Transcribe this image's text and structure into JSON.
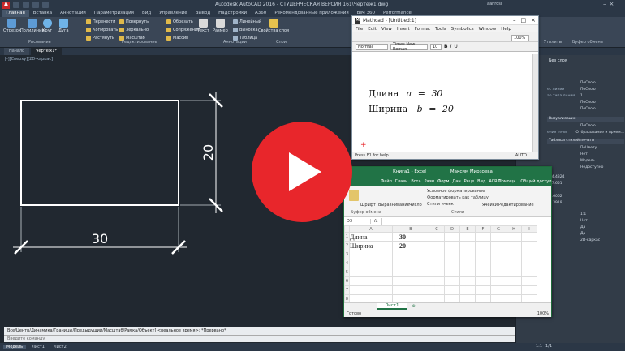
{
  "acad": {
    "title": "Autodesk AutoCAD 2016 - СТУДЕНЧЕСКАЯ ВЕРСИЯ   161\\Чертеж1.dwg",
    "logo": "A",
    "search_hint": "Введите кл. слово/фразу",
    "user": "aahrosl"
  },
  "ribbon_tabs": [
    "Главная",
    "Вставка",
    "Аннотации",
    "Параметризация",
    "Вид",
    "Управление",
    "Вывод",
    "Надстройки",
    "А360",
    "Рекомендованные приложения",
    "BIM 360",
    "Performance"
  ],
  "ribbon": {
    "draw": [
      "Отрезок",
      "Полилиния",
      "Круг",
      "Дуга"
    ],
    "modify": [
      "Перенести",
      "Копировать",
      "Растянуть",
      "Повернуть",
      "Зеркально",
      "Масштаб",
      "Обрезать",
      "Сопряжение",
      "Массив"
    ],
    "annot": [
      "Текст",
      "Размер",
      "Линейный",
      "Выноска",
      "Таблица"
    ],
    "layers": "Свойства слоя",
    "groups": [
      "Рисование",
      "Редактирование",
      "Аннотации",
      "Слои"
    ],
    "right_groups": [
      "Утилиты",
      "Буфер обмена"
    ]
  },
  "doc_tabs": [
    "Начало",
    "Чертеж1*"
  ],
  "viewport_label": "[-][Сверху][2D-каркас]",
  "drawing": {
    "width_dim": "30",
    "height_dim": "20"
  },
  "command": {
    "history": "Все/Центр/Динамика/Границы/Предыдущий/Масштаб/Рамка/Объект] <реальное время>:  *Прервано*",
    "prompt": "Введите команду"
  },
  "status_tabs": [
    "Модель",
    "Лист1",
    "Лист2"
  ],
  "status_right": [
    "1:1",
    "1/1"
  ],
  "palette": {
    "top": "Без слоя",
    "rows": [
      {
        "k": "",
        "v": "ПоСлою"
      },
      {
        "k": "ес линий",
        "v": "ПоСлою"
      },
      {
        "k": "аб типа линий",
        "v": "1"
      },
      {
        "k": "",
        "v": "ПоСлою"
      },
      {
        "k": "",
        "v": "ПоСлою"
      }
    ],
    "section": "Визуализация",
    "rows2": [
      {
        "k": "",
        "v": "ПоСлою"
      },
      {
        "k": "ения тени",
        "v": "Отбрасывание и прием..."
      }
    ],
    "section2": "Таблица стилей печати",
    "rows3": [
      {
        "k": "",
        "v": "ПоЦвету"
      },
      {
        "k": "",
        "v": "Нет"
      },
      {
        "k": "",
        "v": "Модель"
      },
      {
        "k": "",
        "v": "Недоступно"
      }
    ],
    "values": [
      "464.4324",
      "397.651",
      "0",
      "32.6062",
      "82.3919"
    ],
    "bottom": [
      {
        "k": "",
        "v": "1:1"
      },
      {
        "k": "",
        "v": "Нет"
      },
      {
        "k": "",
        "v": "Да"
      },
      {
        "k": "",
        "v": "Да"
      },
      {
        "k": "",
        "v": "2D-каркас"
      }
    ]
  },
  "mathcad": {
    "title": "Mathcad - [Untitled:1]",
    "menu": [
      "File",
      "Edit",
      "View",
      "Insert",
      "Format",
      "Tools",
      "Symbolics",
      "Window",
      "Help"
    ],
    "style": "Normal",
    "font": "Times New Roman",
    "size": "10",
    "zoom": "100%",
    "lines": [
      {
        "label": "Длина",
        "var": "a",
        "eq": "=",
        "val": "30"
      },
      {
        "label": "Ширина",
        "var": "b",
        "eq": "=",
        "val": "20"
      }
    ],
    "status_left": "Press F1 for help.",
    "status_right": "AUTO"
  },
  "excel": {
    "title": "Книга1 - Excel",
    "user": "Максим Мирзоева",
    "tabs": [
      "Файл",
      "Главн",
      "Вста",
      "Разм",
      "Форм",
      "Дан",
      "Реце",
      "Вид",
      "ACRO"
    ],
    "help": "Помощь",
    "share": "Общий доступ",
    "ribbon": [
      "Шрифт",
      "Выравнивание",
      "Число",
      "Условное форматирование",
      "Форматировать как таблицу",
      "Стили ячеек",
      "Ячейки",
      "Редактирование"
    ],
    "styles_group": "Стили",
    "clipboard": "Буфер обмена",
    "name_box": "D3",
    "fx": "fx",
    "columns": [
      "A",
      "B",
      "C",
      "D",
      "E",
      "F",
      "G",
      "H",
      "I"
    ],
    "rows": [
      [
        "Длина",
        "30"
      ],
      [
        "Ширина",
        "20"
      ],
      [
        "",
        ""
      ],
      [
        "",
        ""
      ],
      [
        "",
        ""
      ],
      [
        "",
        ""
      ],
      [
        "",
        ""
      ],
      [
        "",
        ""
      ]
    ],
    "sheet": "Лист1",
    "status_left": "Готово",
    "zoom": "100%"
  }
}
